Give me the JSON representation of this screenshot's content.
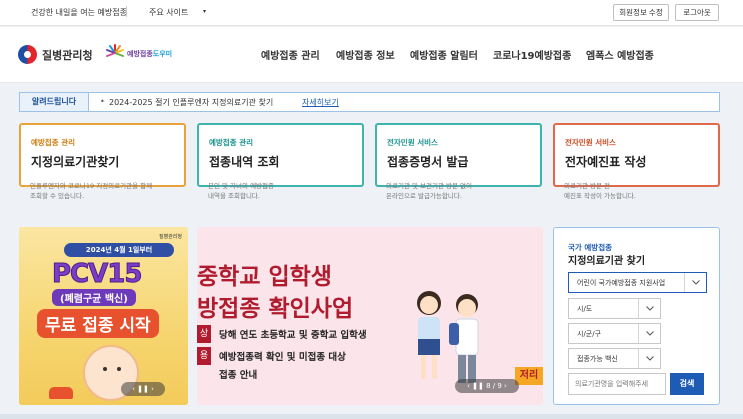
{
  "topbar": {
    "slogan": "건강한 내일을 여는 예방접종",
    "sites_label": "주요 사이트",
    "caret": "▾",
    "edit_profile": "회원정보 수정",
    "logout": "로그아웃"
  },
  "header": {
    "org_name": "질병관리청",
    "vac_logo_a": "예방접종",
    "vac_logo_b": "도우미",
    "nav": [
      "예방접종 관리",
      "예방접종 정보",
      "예방접종 알림터",
      "코로나19예방접종",
      "엠폭스 예방접종"
    ]
  },
  "alert": {
    "tag": "알려드립니다",
    "bullet": "•",
    "message": "2024-2025 절기 인플루엔자 지정의료기관 찾기",
    "more": "자세히보기"
  },
  "cards": [
    {
      "category": "예방접종 관리",
      "title": "지정의료기관찾기",
      "desc1": "인플루엔자와 코로나19 지정의료기관을 함께",
      "desc2": "조회할 수 있습니다."
    },
    {
      "category": "예방접종 관리",
      "title": "접종내역 조회",
      "desc1": "본인 및 자녀의 예방접종",
      "desc2": "내역을 조회합니다."
    },
    {
      "category": "전자민원 서비스",
      "title": "접종증명서 발급",
      "desc1": "의료기관 및 보건기관 방문 없이",
      "desc2": "온라인으로 발급가능합니다."
    },
    {
      "category": "전자민원 서비스",
      "title": "전자예진표 작성",
      "desc1": "의료기관 방문 전",
      "desc2": "예진표 작성이 가능합니다."
    }
  ],
  "banner_left": {
    "ribbon": "2024년 4월 1일부터",
    "headline": "PCV15",
    "sub": "(폐렴구균 백신)",
    "free": "무료 접종 시작",
    "org": "질병관리청",
    "controls": "‹  ❚❚  ›"
  },
  "banner_main": {
    "line1": "중학교 입학생",
    "line2": "방접종 확인사업",
    "label1": "상",
    "label2": "용",
    "body1": "당해 연도 초등학교 및 중학교 입학생",
    "body2": "예방접종력 확인 및 미접종 대상",
    "body3": "접종 안내",
    "next_label": "저리",
    "controls": "‹  ❚❚  8 / 9  ›"
  },
  "search": {
    "category": "국가 예방접종",
    "title": "지정의료기관 찾기",
    "program": "어린이 국가예방접종 지원사업",
    "sido": "시/도",
    "sigungu": "시/군/구",
    "vaccine": "접종가능 백신",
    "placeholder": "의료기관명을 입력해주세",
    "button": "검색"
  },
  "colors": {
    "primary": "#1d5bb5",
    "accent_orange": "#e8a33d",
    "accent_teal": "#3fb3ae",
    "accent_red": "#e0694b"
  }
}
